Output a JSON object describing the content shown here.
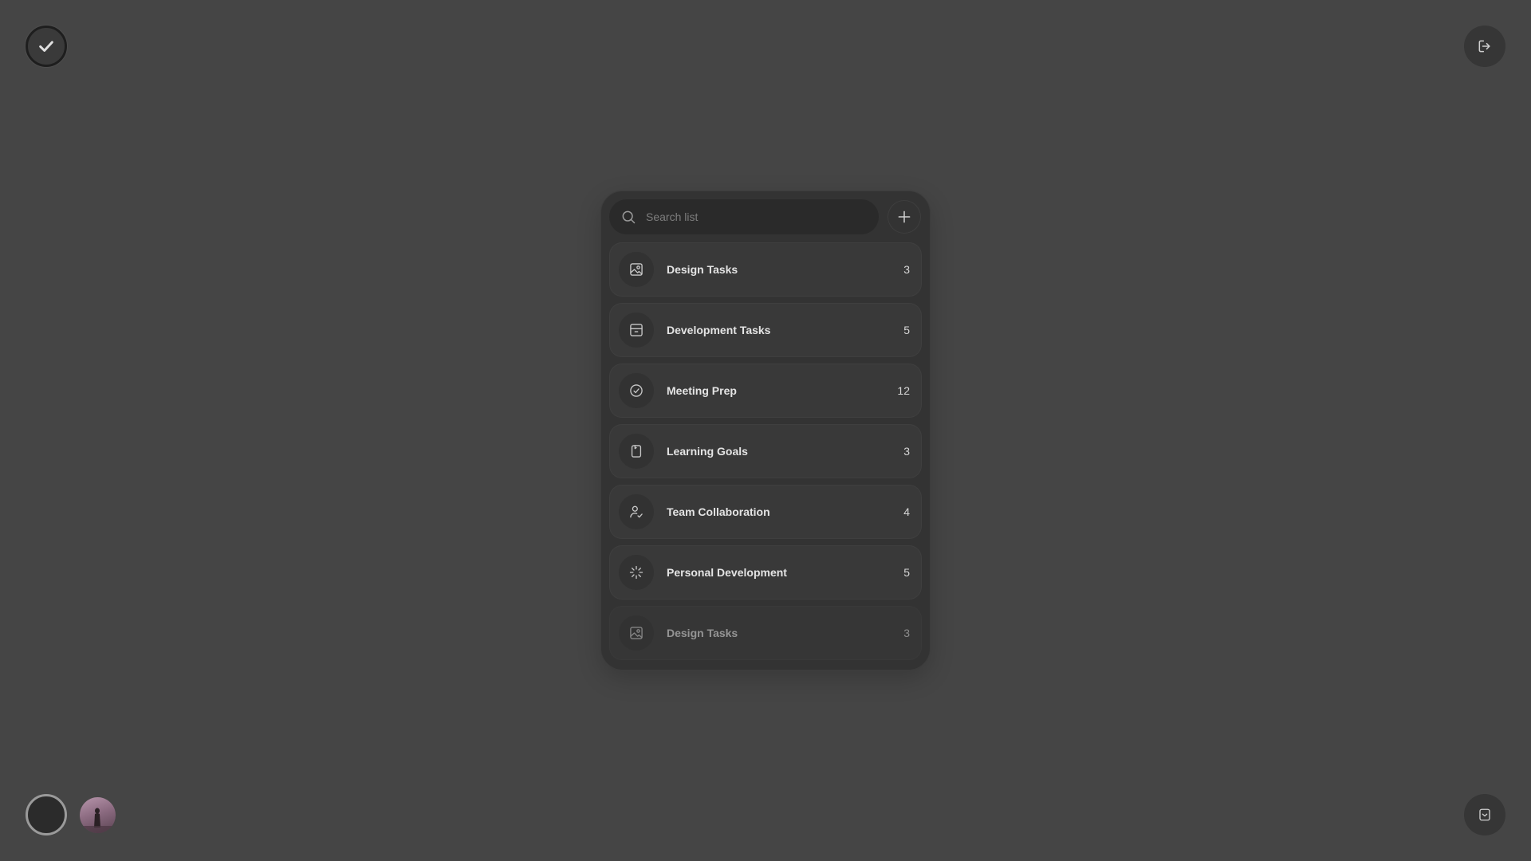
{
  "colors": {
    "background": "#454545",
    "panel": "#333333",
    "item": "#393939",
    "text": "#e4e4e4"
  },
  "top_left": {
    "icon": "check-icon"
  },
  "top_right": {
    "icon": "logout-icon"
  },
  "bottom_left": {
    "theme_icon": "circle-toggle",
    "avatar_icon": "user-avatar"
  },
  "bottom_right": {
    "icon": "save-icon"
  },
  "search": {
    "placeholder": "Search list",
    "value": "",
    "icon": "search-icon"
  },
  "add_button": {
    "icon": "plus-icon"
  },
  "list": {
    "items": [
      {
        "label": "Design Tasks",
        "count": "3",
        "icon": "image-icon"
      },
      {
        "label": "Development Tasks",
        "count": "5",
        "icon": "browser-window-icon"
      },
      {
        "label": "Meeting Prep",
        "count": "12",
        "icon": "check-circle-icon"
      },
      {
        "label": "Learning Goals",
        "count": "3",
        "icon": "bookmark-icon"
      },
      {
        "label": "Team Collaboration",
        "count": "4",
        "icon": "user-check-icon"
      },
      {
        "label": "Personal Development",
        "count": "5",
        "icon": "loader-icon"
      },
      {
        "label": "Design Tasks",
        "count": "3",
        "icon": "image-icon"
      }
    ]
  }
}
